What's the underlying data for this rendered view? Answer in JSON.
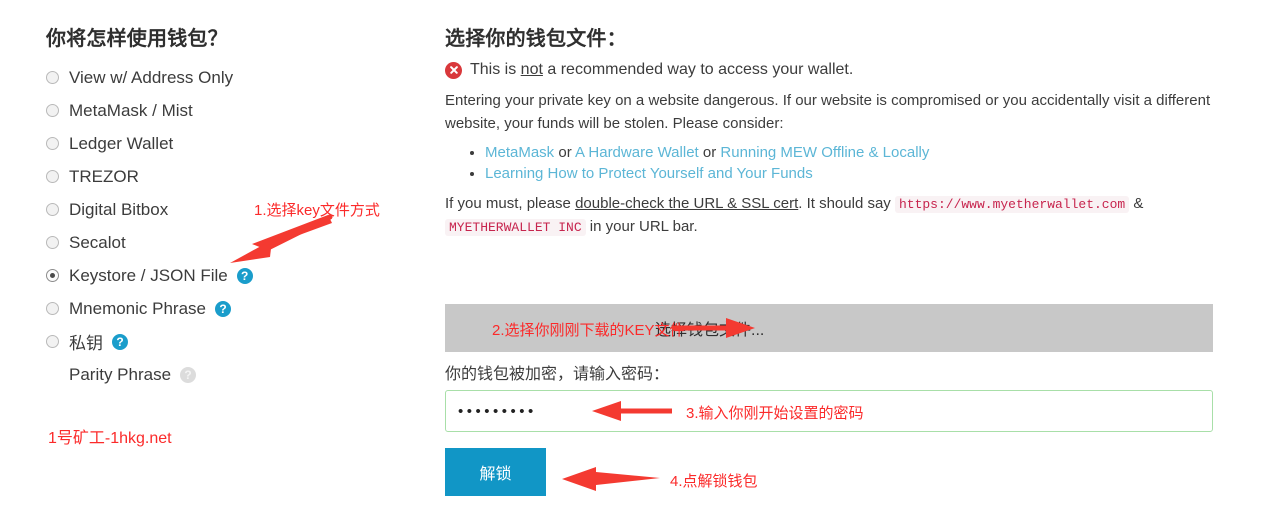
{
  "left": {
    "heading": "你将怎样使用钱包？",
    "options": [
      {
        "label": "View w/ Address Only",
        "selected": false,
        "help": null
      },
      {
        "label": "MetaMask / Mist",
        "selected": false,
        "help": null
      },
      {
        "label": "Ledger Wallet",
        "selected": false,
        "help": null
      },
      {
        "label": "TREZOR",
        "selected": false,
        "help": null
      },
      {
        "label": "Digital Bitbox",
        "selected": false,
        "help": null
      },
      {
        "label": "Secalot",
        "selected": false,
        "help": null
      },
      {
        "label": "Keystore / JSON File",
        "selected": true,
        "help": "?"
      },
      {
        "label": "Mnemonic Phrase",
        "selected": false,
        "help": "?"
      },
      {
        "label": "私钥",
        "selected": false,
        "help": "?"
      },
      {
        "label": "Parity Phrase",
        "selected": false,
        "help": "?",
        "disabled": true
      }
    ],
    "watermark": "1号矿工-1hkg.net"
  },
  "right": {
    "heading": "选择你的钱包文件：",
    "warning": {
      "before": "This is ",
      "emphasis": "not",
      "after": " a recommended way to access your wallet."
    },
    "paragraph": "Entering your private key on a website dangerous. If our website is compromised or you accidentally visit a different website, your funds will be stolen. Please consider:",
    "bullets": [
      {
        "parts": [
          {
            "type": "link",
            "text": "MetaMask"
          },
          {
            "type": "text",
            "text": " or "
          },
          {
            "type": "link",
            "text": "A Hardware Wallet"
          },
          {
            "type": "text",
            "text": " or "
          },
          {
            "type": "link",
            "text": "Running MEW Offline & Locally"
          }
        ]
      },
      {
        "parts": [
          {
            "type": "link",
            "text": "Learning How to Protect Yourself and Your Funds"
          }
        ]
      }
    ],
    "ssl_line": {
      "lead": "If you must, please ",
      "underlined": "double-check the URL & SSL cert",
      "middle": ". It should say ",
      "code1": "https://www.myetherwallet.com",
      "amp": " & ",
      "code2": "MYETHERWALLET INC",
      "tail": " in your URL bar."
    },
    "file_select_label": "选择钱包文件...",
    "password_prompt": "你的钱包被加密，请输入密码：",
    "password_value": "•••••••••",
    "unlock_label": "解锁"
  },
  "annotations": [
    {
      "id": "anno-1",
      "text": "1.选择key文件方式"
    },
    {
      "id": "anno-2",
      "text": "2.选择你刚刚下载的KEY文件"
    },
    {
      "id": "anno-3",
      "text": "3.输入你刚开始设置的密码"
    },
    {
      "id": "anno-4",
      "text": "4.点解锁钱包"
    }
  ],
  "colors": {
    "accent_blue": "#1196c6",
    "annotation_red": "#fb2a2a",
    "link_blue": "#5cb6d6",
    "code_pink": "#c7254e",
    "file_bar_grey": "#c8c8c8",
    "input_border_green": "#a8dfa8",
    "error_red": "#d9383b"
  }
}
